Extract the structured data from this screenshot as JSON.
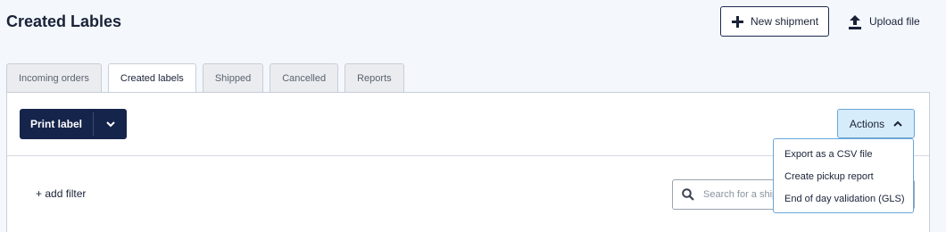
{
  "page": {
    "title": "Created Lables"
  },
  "header_actions": {
    "new_shipment": "New shipment",
    "upload_file": "Upload file"
  },
  "tabs": [
    {
      "label": "Incoming orders",
      "active": false
    },
    {
      "label": "Created labels",
      "active": true
    },
    {
      "label": "Shipped",
      "active": false
    },
    {
      "label": "Cancelled",
      "active": false
    },
    {
      "label": "Reports",
      "active": false
    }
  ],
  "toolbar": {
    "print_label": "Print label",
    "actions_label": "Actions"
  },
  "actions_menu": {
    "items": [
      "Export as a CSV file",
      "Create pickup report",
      "End of day validation (GLS)"
    ]
  },
  "filters": {
    "add_filter": "+ add filter",
    "search_placeholder": "Search for a shipment"
  },
  "colors": {
    "primary": "#15244b",
    "accent_light": "#d7ecfb",
    "accent_border": "#6aa6d8",
    "background": "#f4f8fd"
  },
  "icons": {
    "new_shipment": "plus-icon",
    "upload_file": "upload-icon",
    "print_dropdown": "chevron-down-icon",
    "actions_toggle": "chevron-up-icon",
    "search": "search-icon"
  }
}
